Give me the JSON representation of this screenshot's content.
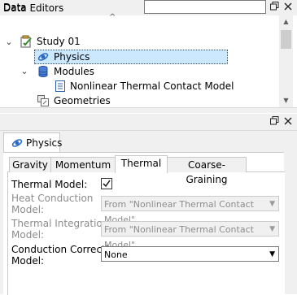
{
  "data_panel": {
    "title": "Data",
    "search_placeholder": "",
    "tree": {
      "study": "Study 01",
      "physics": "Physics",
      "modules": "Modules",
      "model": "Nonlinear Thermal Contact Model",
      "geometries": "Geometries"
    }
  },
  "editors": {
    "title": "Data Editors",
    "main_tab": "Physics",
    "sub_tabs": [
      "Gravity",
      "Momentum",
      "Thermal",
      "Coarse-Graining"
    ],
    "active_sub_tab": "Thermal",
    "fields": {
      "thermal_model_label": "Thermal Model:",
      "thermal_model_checked": true,
      "heat_conduction_label_1": "Heat Conduction",
      "heat_conduction_label_2": "Model:",
      "heat_conduction_value": "From \"Nonlinear Thermal Contact Model\"",
      "thermal_integration_label_1": "Thermal Integration",
      "thermal_integration_label_2": "Model:",
      "thermal_integration_value": "From \"Nonlinear Thermal Contact Model\"",
      "conduction_correction_label_1": "Conduction Correction",
      "conduction_correction_label_2": "Model:",
      "conduction_correction_value": "None"
    }
  },
  "colors": {
    "selection": "#cce8ff",
    "panel_bg": "#f0f0f0",
    "disabled_text": "#8c8c8c"
  },
  "icons": {
    "restore": "restore-window-icon",
    "close": "close-icon",
    "study": "study-icon",
    "physics": "physics-icon",
    "modules": "database-icon",
    "model": "document-icon",
    "geometries": "geometries-icon"
  }
}
